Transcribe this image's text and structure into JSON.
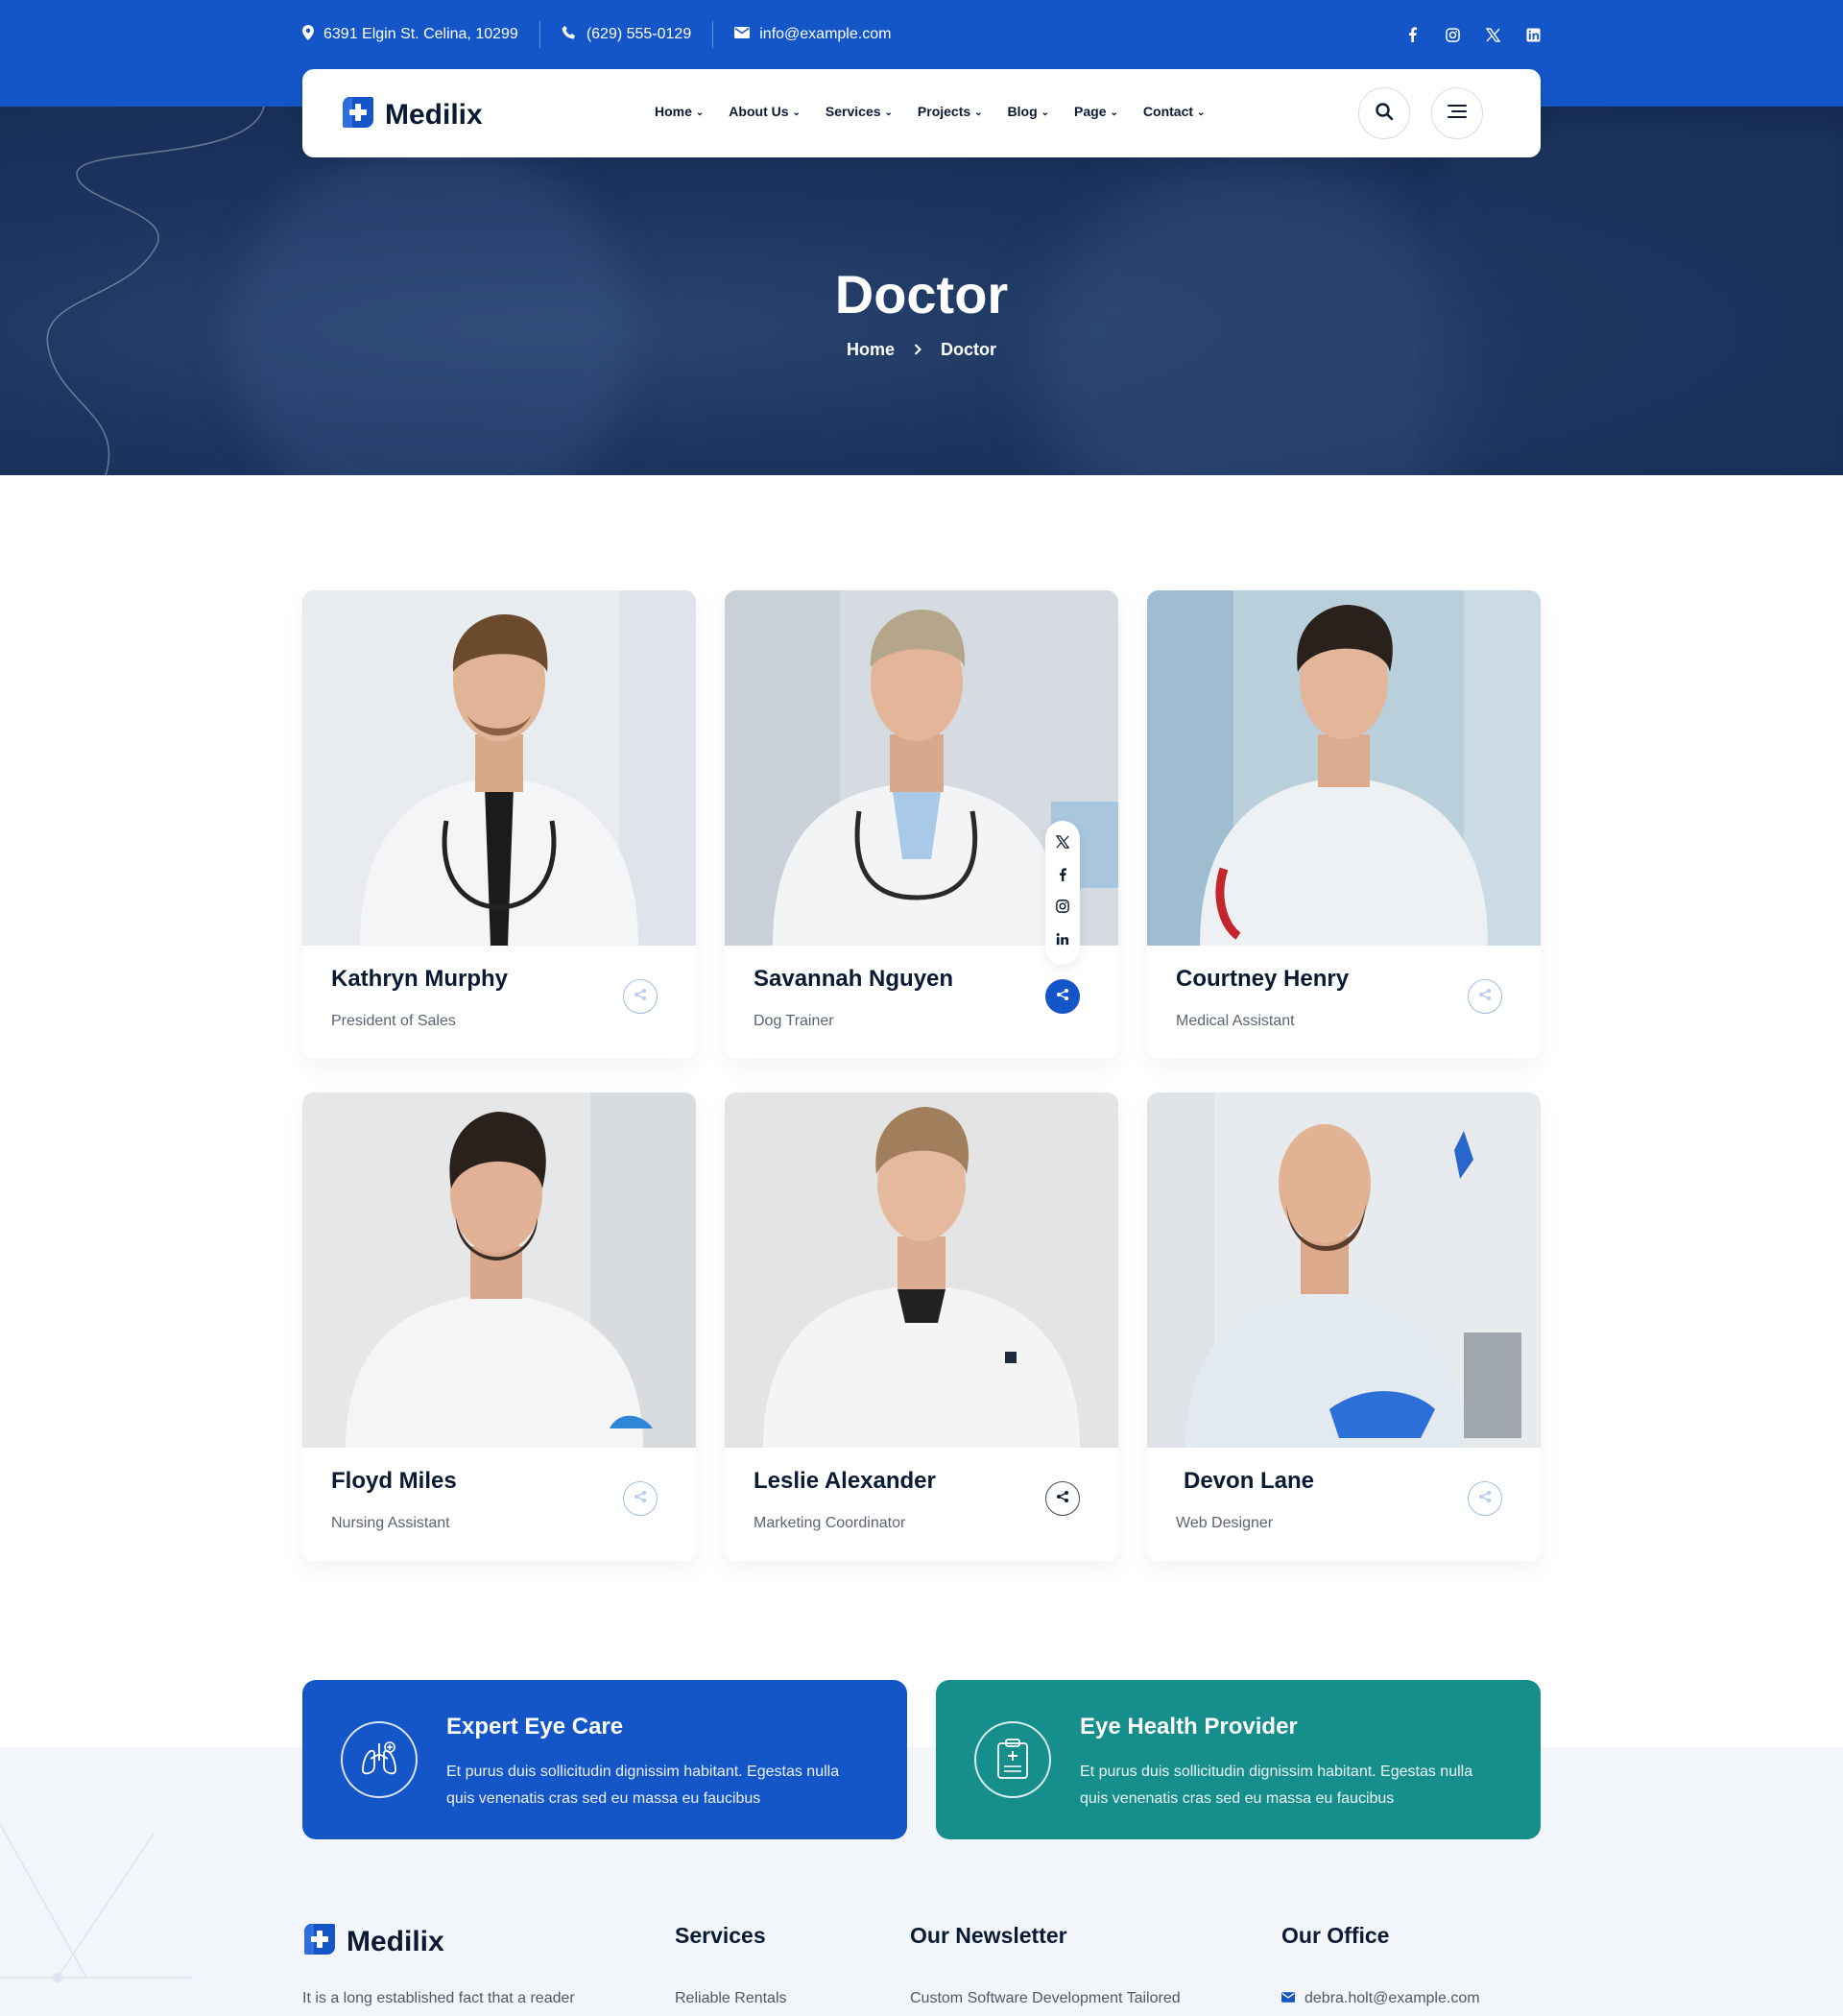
{
  "topbar": {
    "address": "6391 Elgin St. Celina, 10299",
    "phone": "(629) 555-0129",
    "email": "info@example.com",
    "social": [
      "facebook-icon",
      "instagram-icon",
      "x-icon",
      "linkedin-icon"
    ]
  },
  "brand": {
    "name": "Medilix",
    "primary": "#1455c8",
    "teal": "#168f8c",
    "dark": "#0b1a33"
  },
  "nav": {
    "items": [
      {
        "label": "Home"
      },
      {
        "label": "About Us"
      },
      {
        "label": "Services"
      },
      {
        "label": "Projects"
      },
      {
        "label": "Blog"
      },
      {
        "label": "Page"
      },
      {
        "label": "Contact"
      }
    ]
  },
  "hero": {
    "title": "Doctor",
    "breadcrumb": [
      "Home",
      "Doctor"
    ]
  },
  "doctors": [
    {
      "name": "Kathryn Murphy",
      "role": "President of Sales"
    },
    {
      "name": "Savannah Nguyen",
      "role": "Dog Trainer"
    },
    {
      "name": "Courtney Henry",
      "role": "Medical Assistant"
    },
    {
      "name": "Floyd Miles",
      "role": "Nursing Assistant"
    },
    {
      "name": "Leslie Alexander",
      "role": "Marketing Coordinator"
    },
    {
      "name": "Devon Lane",
      "role": "Web Designer"
    }
  ],
  "features": [
    {
      "title": "Expert Eye Care",
      "text": "Et purus duis sollicitudin dignissim habitant. Egestas nulla quis venenatis cras sed eu massa eu faucibus"
    },
    {
      "title": "Eye Health Provider",
      "text": "Et purus duis sollicitudin dignissim habitant. Egestas nulla quis venenatis cras sed eu massa eu faucibus"
    }
  ],
  "footer": {
    "about": "It is a long established fact that a reader",
    "services_title": "Services",
    "services_first": "Reliable Rentals",
    "newsletter_title": "Our Newsletter",
    "newsletter_text": "Custom Software Development Tailored",
    "office_title": "Our Office",
    "office_email": "debra.holt@example.com"
  }
}
